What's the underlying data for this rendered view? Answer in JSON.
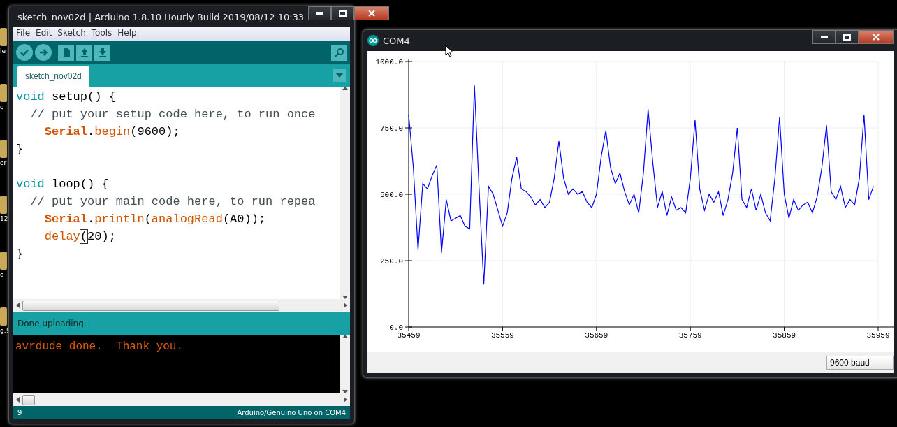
{
  "desktop_icons": [
    {
      "label": "le"
    },
    {
      "label": "g"
    },
    {
      "label": "or"
    },
    {
      "label": "12"
    },
    {
      "label": "o"
    },
    {
      "label": "g.!"
    }
  ],
  "ide_window": {
    "title": "sketch_nov02d | Arduino 1.8.10 Hourly Build 2019/08/12 10:33",
    "menu": [
      "File",
      "Edit",
      "Sketch",
      "Tools",
      "Help"
    ],
    "toolbar": [
      {
        "kind": "verify"
      },
      {
        "kind": "upload"
      },
      {
        "kind": "new"
      },
      {
        "kind": "open"
      },
      {
        "kind": "save"
      }
    ],
    "tabs": [
      {
        "label": "sketch_nov02d",
        "selected": true
      }
    ],
    "code_lines": [
      {
        "blank_before": false,
        "tokens": [
          {
            "kind": "keyword",
            "text": "void"
          },
          {
            "kind": "plain",
            "text": " setup() {"
          }
        ]
      },
      {
        "blank_before": false,
        "tokens": [
          {
            "kind": "comment",
            "text": "  // put your setup code here, to run once"
          }
        ]
      },
      {
        "blank_before": false,
        "tokens": [
          {
            "kind": "class",
            "text": "    Serial"
          },
          {
            "kind": "plain",
            "text": "."
          },
          {
            "kind": "function",
            "text": "begin"
          },
          {
            "kind": "plain",
            "text": "(9600);"
          }
        ]
      },
      {
        "blank_before": false,
        "tokens": [
          {
            "kind": "plain",
            "text": "}"
          }
        ]
      },
      {
        "blank_before": true,
        "tokens": [
          {
            "kind": "keyword",
            "text": "void"
          },
          {
            "kind": "plain",
            "text": " loop() {"
          }
        ]
      },
      {
        "blank_before": false,
        "tokens": [
          {
            "kind": "comment",
            "text": "  // put your main code here, to run repea"
          }
        ]
      },
      {
        "blank_before": false,
        "tokens": [
          {
            "kind": "class",
            "text": "    Serial"
          },
          {
            "kind": "plain",
            "text": "."
          },
          {
            "kind": "function",
            "text": "println"
          },
          {
            "kind": "plain",
            "text": "("
          },
          {
            "kind": "function",
            "text": "analogRead"
          },
          {
            "kind": "plain",
            "text": "(A0));"
          }
        ]
      },
      {
        "blank_before": false,
        "tokens": [
          {
            "kind": "function",
            "text": "    delay"
          },
          {
            "kind": "match",
            "text": "("
          },
          {
            "kind": "plain",
            "text": "20);"
          }
        ]
      },
      {
        "blank_before": false,
        "tokens": [
          {
            "kind": "plain",
            "text": "}"
          }
        ]
      }
    ],
    "status_message": "Done uploading.",
    "console_lines": [
      "avrdude done.  Thank you."
    ],
    "footer": {
      "line": "9",
      "board": "Arduino/Genuino Uno on COM4"
    }
  },
  "plotter_window": {
    "title": "COM4",
    "chart_data": {
      "type": "line",
      "grid": true,
      "xlim": [
        35459,
        35959
      ],
      "ylim": [
        0,
        1000
      ],
      "xticks": [
        35459,
        35559,
        35659,
        35759,
        35859,
        35959
      ],
      "yticks": [
        {
          "value": 0,
          "label": "0.0"
        },
        {
          "value": 250,
          "label": "250.0"
        },
        {
          "value": 500,
          "label": "500.0"
        },
        {
          "value": 750,
          "label": "750.0"
        },
        {
          "value": 1000,
          "label": "1000.0"
        }
      ],
      "x": [
        35459,
        35464,
        35469,
        35474,
        35479,
        35484,
        35489,
        35494,
        35499,
        35504,
        35509,
        35514,
        35519,
        35524,
        35529,
        35534,
        35539,
        35544,
        35549,
        35554,
        35559,
        35564,
        35569,
        35574,
        35579,
        35584,
        35589,
        35594,
        35599,
        35604,
        35609,
        35614,
        35619,
        35624,
        35629,
        35634,
        35639,
        35644,
        35649,
        35654,
        35659,
        35664,
        35669,
        35674,
        35679,
        35684,
        35689,
        35694,
        35699,
        35704,
        35709,
        35714,
        35719,
        35724,
        35729,
        35734,
        35739,
        35744,
        35749,
        35754,
        35759,
        35764,
        35769,
        35774,
        35779,
        35784,
        35789,
        35794,
        35799,
        35804,
        35809,
        35814,
        35819,
        35824,
        35829,
        35834,
        35839,
        35844,
        35849,
        35854,
        35859,
        35864,
        35869,
        35874,
        35879,
        35884,
        35889,
        35894,
        35899,
        35904,
        35909,
        35914,
        35919,
        35924,
        35929,
        35934,
        35939,
        35944,
        35949,
        35954
      ],
      "series": [
        {
          "color": "#0000ff",
          "values": [
            800,
            600,
            290,
            540,
            520,
            570,
            610,
            280,
            480,
            400,
            410,
            420,
            380,
            370,
            910,
            520,
            160,
            530,
            500,
            440,
            380,
            430,
            560,
            640,
            520,
            510,
            490,
            460,
            480,
            450,
            470,
            560,
            700,
            560,
            500,
            520,
            500,
            510,
            470,
            450,
            500,
            640,
            740,
            600,
            540,
            580,
            510,
            460,
            500,
            430,
            580,
            820,
            620,
            450,
            510,
            420,
            490,
            440,
            450,
            430,
            560,
            780,
            520,
            440,
            500,
            470,
            510,
            420,
            480,
            580,
            750,
            480,
            450,
            520,
            440,
            500,
            430,
            400,
            560,
            790,
            500,
            410,
            480,
            440,
            460,
            470,
            430,
            490,
            600,
            760,
            510,
            480,
            530,
            450,
            480,
            460,
            560,
            800,
            480,
            530
          ]
        }
      ]
    },
    "baud": "9600 baud"
  }
}
